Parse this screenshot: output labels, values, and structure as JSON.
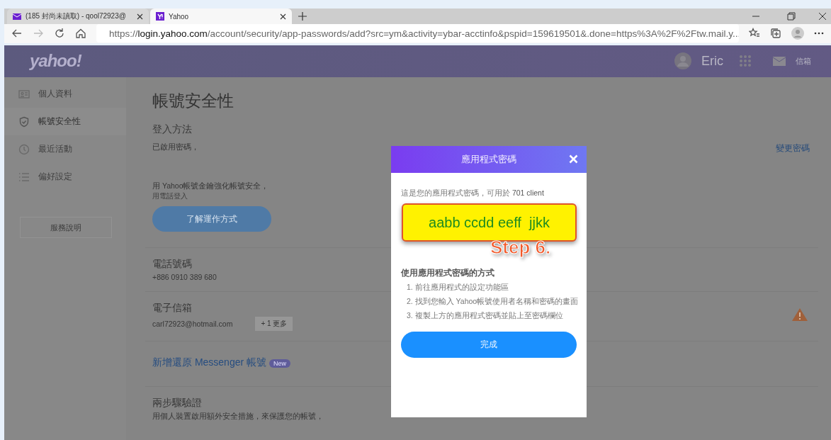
{
  "browser": {
    "tabs": [
      {
        "kind": "mail",
        "title": "(185 封尚未讀取) - qool72923@",
        "selected": false
      },
      {
        "kind": "yahoo",
        "title": "Yahoo",
        "selected": true
      }
    ],
    "url": {
      "scheme": "https://",
      "host": "login.yahoo.com",
      "path": "/account/security/app-passwords/add?src=ym&activity=ybar-acctinfo&pspid=159619501&.done=https%3A%2F%2Ftw.mail.y..."
    }
  },
  "header": {
    "logo": "yahoo!",
    "user": "Eric",
    "mail": "信箱"
  },
  "sidebar": {
    "items": [
      {
        "kind": "profile",
        "label": "個人資料",
        "selected": false
      },
      {
        "kind": "security",
        "label": "帳號安全性",
        "selected": true
      },
      {
        "kind": "activity",
        "label": "最近活動",
        "selected": false
      },
      {
        "kind": "preferences",
        "label": "偏好設定",
        "selected": false
      }
    ],
    "help_button": "服務說明"
  },
  "content": {
    "title": "帳號安全性",
    "login": {
      "title": "登入方法",
      "status": "已啟用密碼，",
      "change_link": "變更密碼",
      "promo": "用 Yahoo帳號金鑰強化帳號安全，",
      "promo_sub": "用電話登入",
      "learn_button": "了解運作方式"
    },
    "phone": {
      "title": "電話號碼",
      "value": "+886 0910 389 680"
    },
    "email": {
      "title": "電子信箱",
      "value": "carl72923@hotmail.com",
      "more": "+ 1 更多"
    },
    "messenger": {
      "link": "新增還原 Messenger 帳號",
      "badge": "New"
    },
    "two_step": {
      "title": "兩步驟驗證",
      "text": "用個人裝置啟用額外安全措施，來保護您的帳號，"
    }
  },
  "modal": {
    "title": "應用程式密碼",
    "intro": "這是您的應用程式密碼，可用於 **701 client**",
    "password": "aabb ccdd eeff  jjkk",
    "annotation": "Step 6.",
    "steps_title": "使用應用程式密碼的方式",
    "steps": [
      "1. 前往應用程式的設定功能區",
      "2. 找到您輸入 Yahoo帳號使用者名稱和密碼的畫面",
      "3. 複製上方的應用程式密碼並貼上至密碼欄位"
    ],
    "done_button": "完成"
  }
}
